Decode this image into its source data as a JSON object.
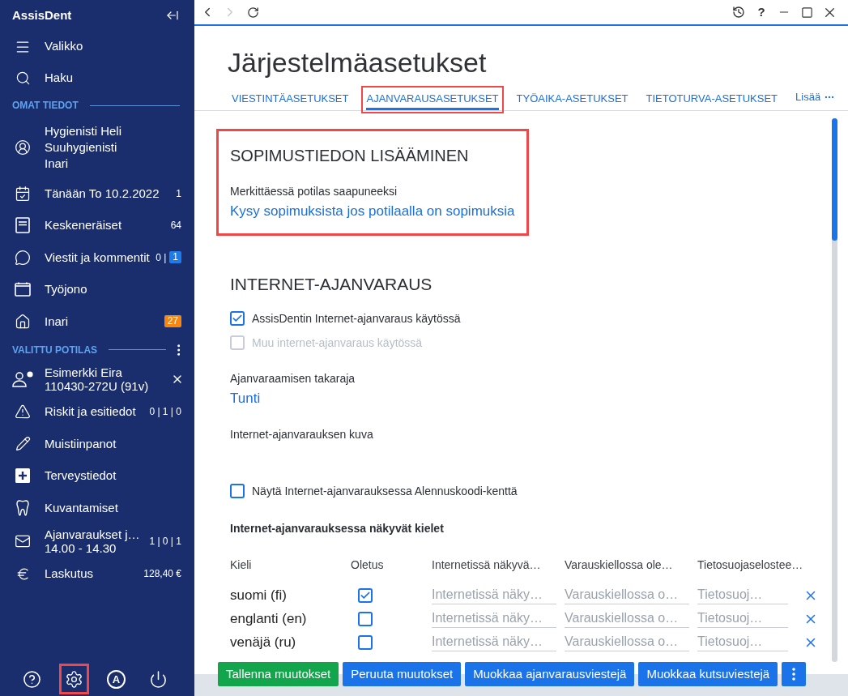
{
  "sidebar": {
    "app_title": "AssisDent",
    "nav": [
      {
        "label": "Valikko"
      },
      {
        "label": "Haku"
      }
    ],
    "sections": [
      {
        "title": "OMAT TIEDOT",
        "has_menu": false,
        "items": [
          {
            "lines": [
              "Hygienisti Heli",
              "Suuhygienisti",
              "Inari"
            ]
          },
          {
            "lines": [
              "Tänään To 10.2.2022"
            ],
            "count": "1"
          },
          {
            "lines": [
              "Keskeneräiset"
            ],
            "count": "64"
          },
          {
            "lines": [
              "Viestit ja kommentit"
            ],
            "count": "0 |",
            "badge": {
              "text": "1",
              "color": "#1e7ce8"
            }
          },
          {
            "lines": [
              "Työjono"
            ]
          },
          {
            "lines": [
              "Inari"
            ],
            "badge": {
              "text": "27",
              "color": "#f7860f"
            }
          }
        ]
      },
      {
        "title": "VALITTU POTILAS",
        "has_menu": true,
        "items": [
          {
            "lines": [
              "Esimerkki Eira",
              "110430-272U (91v)"
            ],
            "closable": true
          },
          {
            "lines": [
              "Riskit ja esitiedot"
            ],
            "count": "0 | 1 | 0"
          },
          {
            "lines": [
              "Muistiinpanot"
            ]
          },
          {
            "lines": [
              "Terveystiedot"
            ]
          },
          {
            "lines": [
              "Kuvantamiset"
            ]
          },
          {
            "lines": [
              "Ajanvaraukset j…",
              "14.00 - 14.30"
            ],
            "count": "1 | 0 | 1"
          },
          {
            "lines": [
              "Laskutus"
            ],
            "count": "128,40 €"
          }
        ]
      }
    ],
    "footer_buttons": [
      {
        "highlighted": false
      },
      {
        "highlighted": true
      },
      {
        "label": "A",
        "highlighted": false
      },
      {
        "highlighted": false
      }
    ]
  },
  "topbar": {
    "nav_buttons": [
      {
        "disabled": false
      },
      {
        "disabled": true
      }
    ],
    "help_label": "?"
  },
  "main": {
    "title": "Järjestelmäasetukset",
    "tabs": [
      {
        "label": "VIESTINTÄASETUKSET",
        "selected": false,
        "highlighted": false
      },
      {
        "label": "AJANVARAUSASETUKSET",
        "selected": true,
        "highlighted": true
      },
      {
        "label": "TYÖAIKA-ASETUKSET",
        "selected": false,
        "highlighted": false
      },
      {
        "label": "TIETOTURVA-ASETUKSET",
        "selected": false,
        "highlighted": false
      }
    ],
    "more_label": "Lisää",
    "contract": {
      "title": "SOPIMUSTIEDON LISÄÄMINEN",
      "highlighted": true,
      "label": "Merkittäessä potilas saapuneeksi",
      "value": "Kysy sopimuksista jos potilaalla on sopimuksia"
    },
    "internet_booking": {
      "title": "INTERNET-AJANVARAUS",
      "options": [
        {
          "label": "AssisDentin Internet-ajanvaraus käytössä",
          "checked": true,
          "disabled": false
        },
        {
          "label": "Muu internet-ajanvaraus käytössä",
          "checked": false,
          "disabled": true
        }
      ],
      "deadline": {
        "label": "Ajanvaraamisen takaraja",
        "value": "Tunti"
      },
      "image": {
        "label": "Internet-ajanvarauksen kuva"
      },
      "discount_option": {
        "label": "Näytä Internet-ajanvarauksessa Alennuskoodi-kenttä",
        "checked": false,
        "disabled": false
      },
      "languages": {
        "title": "Internet-ajanvarauksessa näkyvät kielet",
        "columns": [
          "Kieli",
          "Oletus",
          "Internetissä näkyvä…",
          "Varauskiellossa ole…",
          "Tietosuojaselostee…"
        ],
        "rows": [
          {
            "language": "suomi (fi)",
            "default": true,
            "placeholders": [
              "Internetissä näky…",
              "Varauskiellossa o…",
              "Tietosuoj…"
            ]
          },
          {
            "language": "englanti (en)",
            "default": false,
            "placeholders": [
              "Internetissä näky…",
              "Varauskiellossa o…",
              "Tietosuoj…"
            ]
          },
          {
            "language": "venäjä (ru)",
            "default": false,
            "placeholders": [
              "Internetissä näky…",
              "Varauskiellossa o…",
              "Tietosuoj…"
            ]
          }
        ]
      }
    }
  },
  "footer": {
    "buttons": [
      {
        "label": "Tallenna muutokset",
        "kind": "save"
      },
      {
        "label": "Peruuta muutokset",
        "kind": "action"
      },
      {
        "label": "Muokkaa ajanvarausviestejä",
        "kind": "action"
      },
      {
        "label": "Muokkaa kutsuviestejä",
        "kind": "action"
      }
    ]
  }
}
